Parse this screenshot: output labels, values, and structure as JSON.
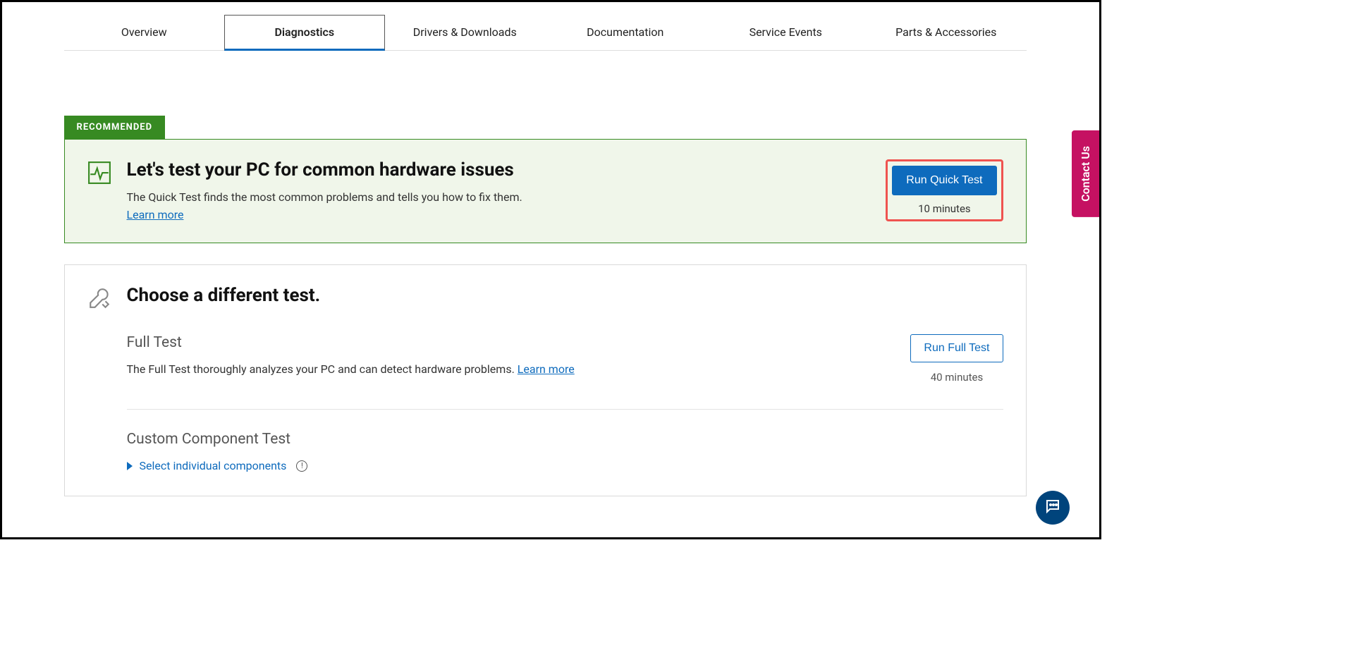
{
  "tabs": {
    "overview": "Overview",
    "diagnostics": "Diagnostics",
    "drivers": "Drivers & Downloads",
    "documentation": "Documentation",
    "service": "Service Events",
    "parts": "Parts & Accessories"
  },
  "recommended": {
    "badge": "RECOMMENDED",
    "title": "Let's test your PC for common hardware issues",
    "desc": "The Quick Test finds the most common problems and tells you how to fix them.",
    "learn_more": "Learn more",
    "button": "Run Quick Test",
    "time": "10 minutes"
  },
  "alt": {
    "title": "Choose a different test.",
    "full": {
      "name": "Full Test",
      "desc": "The Full Test thoroughly analyzes your PC and can detect hardware problems. ",
      "learn_more": "Learn more",
      "button": "Run Full Test",
      "time": "40 minutes"
    },
    "custom": {
      "name": "Custom Component Test",
      "select": "Select individual components"
    }
  },
  "contact_us": "Contact Us"
}
